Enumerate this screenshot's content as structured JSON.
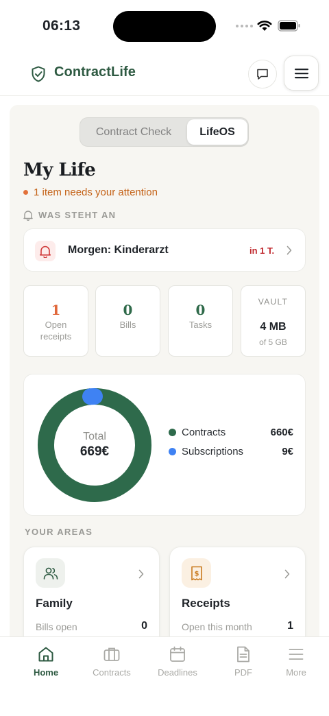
{
  "status_bar": {
    "time": "06:13"
  },
  "header": {
    "brand": "ContractLife"
  },
  "segment": {
    "option_a": "Contract Check",
    "option_b": "LifeOS",
    "selected": "LifeOS"
  },
  "page": {
    "title": "My Life",
    "attention": "1 item needs your attention"
  },
  "upcoming": {
    "section_label": "WAS STEHT AN",
    "item_title": "Morgen: Kinderarzt",
    "item_when": "in 1 T."
  },
  "stats": [
    {
      "value": "1",
      "label": "Open receipts"
    },
    {
      "value": "0",
      "label": "Bills"
    },
    {
      "value": "0",
      "label": "Tasks"
    }
  ],
  "vault": {
    "label": "VAULT",
    "value": "4 MB",
    "sub": "of 5 GB"
  },
  "summary": {
    "total_label": "Total",
    "total_value": "669€",
    "legend": [
      {
        "name": "Contracts",
        "value": "660€",
        "color": "#2e6a4b"
      },
      {
        "name": "Subscriptions",
        "value": "9€",
        "color": "#3f82f3"
      }
    ]
  },
  "chart_data": {
    "type": "pie",
    "categories": [
      "Contracts",
      "Subscriptions"
    ],
    "values": [
      660,
      9
    ],
    "title": "",
    "center_label": "Total",
    "center_value": "669€"
  },
  "areas": {
    "section_label": "YOUR AREAS",
    "cards": [
      {
        "title": "Family",
        "sub": "Bills open",
        "count": "0",
        "icon": "people-icon",
        "icon_bg": "#eef1ed"
      },
      {
        "title": "Receipts",
        "sub": "Open this month",
        "count": "1",
        "icon": "receipt-icon",
        "icon_bg": "#fbf0e2"
      }
    ]
  },
  "tabs": [
    {
      "label": "Home",
      "icon": "home-icon",
      "active": true
    },
    {
      "label": "Contracts",
      "icon": "briefcase-icon",
      "active": false
    },
    {
      "label": "Deadlines",
      "icon": "calendar-icon",
      "active": false
    },
    {
      "label": "PDF",
      "icon": "document-icon",
      "active": false
    },
    {
      "label": "More",
      "icon": "menu-icon",
      "active": false
    }
  ],
  "colors": {
    "brand": "#2e5a42",
    "attention": "#c46217",
    "alert": "#c0292e",
    "contracts": "#2e6a4b",
    "subscriptions": "#3f82f3"
  }
}
